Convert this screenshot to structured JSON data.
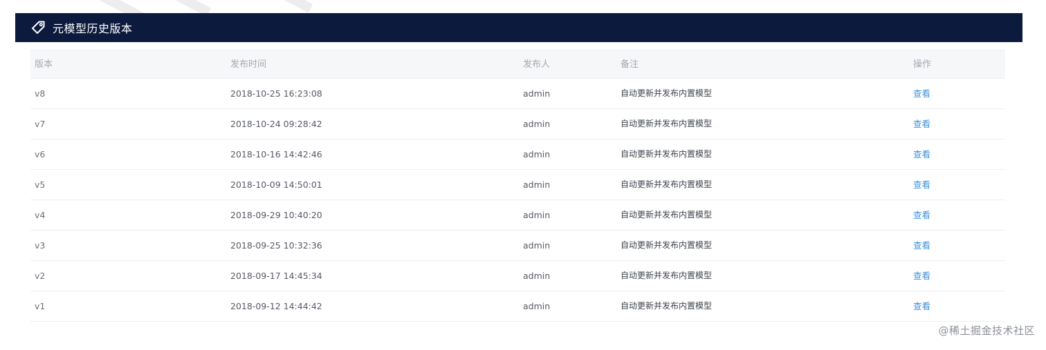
{
  "header": {
    "title": "元模型历史版本",
    "icon": "tag-icon"
  },
  "table": {
    "columns": {
      "version": "版本",
      "published_at": "发布时间",
      "publisher": "发布人",
      "remark": "备注",
      "actions": "操作"
    },
    "rows": [
      {
        "version": "v8",
        "published_at": "2018-10-25 16:23:08",
        "publisher": "admin",
        "remark": "自动更新并发布内置模型",
        "action": "查看"
      },
      {
        "version": "v7",
        "published_at": "2018-10-24 09:28:42",
        "publisher": "admin",
        "remark": "自动更新并发布内置模型",
        "action": "查看"
      },
      {
        "version": "v6",
        "published_at": "2018-10-16 14:42:46",
        "publisher": "admin",
        "remark": "自动更新并发布内置模型",
        "action": "查看"
      },
      {
        "version": "v5",
        "published_at": "2018-10-09 14:50:01",
        "publisher": "admin",
        "remark": "自动更新并发布内置模型",
        "action": "查看"
      },
      {
        "version": "v4",
        "published_at": "2018-09-29 10:40:20",
        "publisher": "admin",
        "remark": "自动更新并发布内置模型",
        "action": "查看"
      },
      {
        "version": "v3",
        "published_at": "2018-09-25 10:32:36",
        "publisher": "admin",
        "remark": "自动更新并发布内置模型",
        "action": "查看"
      },
      {
        "version": "v2",
        "published_at": "2018-09-17 14:45:34",
        "publisher": "admin",
        "remark": "自动更新并发布内置模型",
        "action": "查看"
      },
      {
        "version": "v1",
        "published_at": "2018-09-12 14:44:42",
        "publisher": "admin",
        "remark": "自动更新并发布内置模型",
        "action": "查看"
      }
    ]
  },
  "watermark": "@稀土掘金技术社区",
  "colors": {
    "header_bg": "#0c1a3d",
    "link": "#3c8fdc",
    "header_text": "#ffffff"
  }
}
